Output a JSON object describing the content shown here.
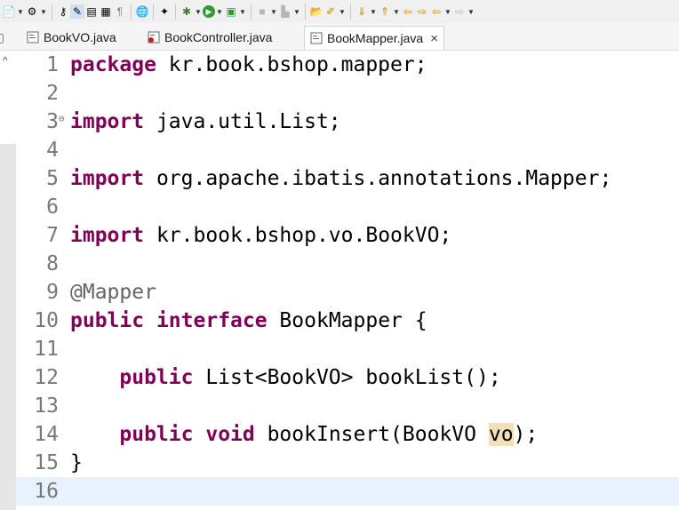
{
  "toolbar": {
    "icons": [
      "new-icon",
      "dropdown",
      "new-wizard-icon",
      "dropdown",
      "open-type-icon",
      "toggle-mark-occurrences-icon",
      "block-selection-icon",
      "word-wrap-icon",
      "show-whitespace-icon",
      "browser-icon",
      "external-tools-icon",
      "debug-icon",
      "dropdown",
      "run-icon",
      "dropdown",
      "coverage-icon",
      "dropdown",
      "stop-icon",
      "dropdown",
      "server-icon",
      "dropdown",
      "open-task-icon",
      "search-icon",
      "dropdown",
      "next-annotation-icon",
      "dropdown",
      "previous-annotation-icon",
      "dropdown",
      "last-edit-icon",
      "back-icon",
      "dropdown",
      "forward-icon",
      "dropdown"
    ]
  },
  "tabs": [
    {
      "label": "BookVO.java",
      "active": false
    },
    {
      "label": "BookController.java",
      "active": false
    },
    {
      "label": "BookMapper.java",
      "active": true,
      "close": "×"
    }
  ],
  "editor": {
    "lines": [
      {
        "n": "1",
        "tokens": [
          {
            "t": "package",
            "c": "kw"
          },
          {
            "t": " kr.book.bshop.mapper;"
          }
        ]
      },
      {
        "n": "2",
        "tokens": []
      },
      {
        "n": "3",
        "fold": "⊖",
        "tokens": [
          {
            "t": "import",
            "c": "kw"
          },
          {
            "t": " java.util.List;"
          }
        ]
      },
      {
        "n": "4",
        "tokens": []
      },
      {
        "n": "5",
        "tokens": [
          {
            "t": "import",
            "c": "kw"
          },
          {
            "t": " org.apache.ibatis.annotations.Mapper;"
          }
        ]
      },
      {
        "n": "6",
        "tokens": []
      },
      {
        "n": "7",
        "tokens": [
          {
            "t": "import",
            "c": "kw"
          },
          {
            "t": " kr.book.bshop.vo.BookVO;"
          }
        ]
      },
      {
        "n": "8",
        "tokens": []
      },
      {
        "n": "9",
        "tokens": [
          {
            "t": "@Mapper",
            "c": "ann"
          }
        ]
      },
      {
        "n": "10",
        "tokens": [
          {
            "t": "public",
            "c": "kw"
          },
          {
            "t": " "
          },
          {
            "t": "interface",
            "c": "kw"
          },
          {
            "t": " BookMapper {"
          }
        ]
      },
      {
        "n": "11",
        "tokens": []
      },
      {
        "n": "12",
        "tokens": [
          {
            "t": "    "
          },
          {
            "t": "public",
            "c": "kw"
          },
          {
            "t": " List<BookVO> bookList();"
          }
        ]
      },
      {
        "n": "13",
        "tokens": []
      },
      {
        "n": "14",
        "tokens": [
          {
            "t": "    "
          },
          {
            "t": "public",
            "c": "kw"
          },
          {
            "t": " "
          },
          {
            "t": "void",
            "c": "kw"
          },
          {
            "t": " bookInsert(BookVO "
          },
          {
            "t": "vo",
            "c": "hl"
          },
          {
            "t": ");"
          }
        ]
      },
      {
        "n": "15",
        "tokens": [
          {
            "t": "}"
          }
        ]
      },
      {
        "n": "16",
        "tokens": [],
        "current": true
      }
    ]
  }
}
